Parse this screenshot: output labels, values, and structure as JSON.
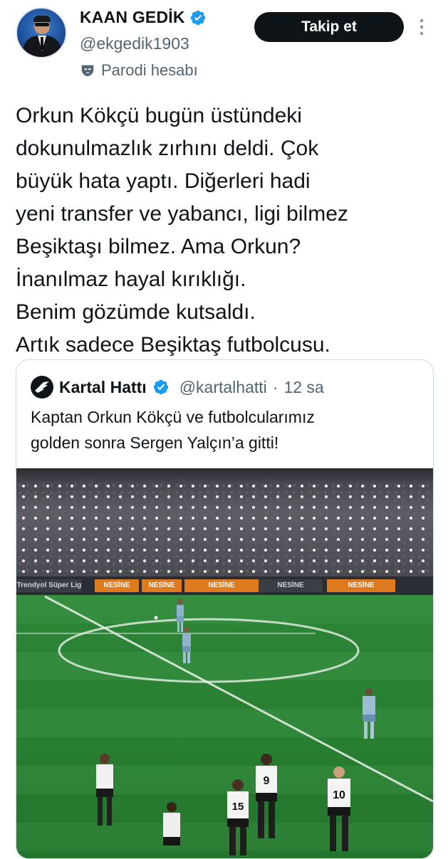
{
  "author": {
    "name": "KAAN GEDİK",
    "handle": "@ekgedik1903",
    "parody_label": "Parodi hesabı",
    "verified": true
  },
  "actions": {
    "follow_label": "Takip et",
    "more_icon": "more-vertical-icon"
  },
  "tweet": {
    "text": "Orkun Kökçü bugün üstündeki\ndokunulmazlık zırhını deldi. Çok\nbüyük hata yaptı. Diğerleri hadi\nyeni transfer ve yabancı, ligi bilmez\nBeşiktaşı bilmez. Ama Orkun?\nİnanılmaz hayal kırıklığı.\nBenim gözümde kutsaldı.\nArtık sadece Beşiktaş futbolcusu."
  },
  "quoted": {
    "name": "Kartal Hattı",
    "handle": "@kartalhatti",
    "separator": "·",
    "time": "12 sa",
    "text": "Kaptan Orkun Kökçü ve futbolcularımız\ngolden sonra Sergen Yalçın’a gitti!",
    "media": {
      "description_icon": "stadium-photo",
      "ads": [
        "NESİNE",
        "NESİNE",
        "NESİNE",
        "NESİNE",
        "NESİNE"
      ],
      "league_text": "Trendyol Süper Lig",
      "jersey_numbers": [
        "9",
        "15",
        "10"
      ]
    }
  },
  "colors": {
    "text_primary": "#0f1419",
    "text_secondary": "#536471",
    "verified_blue": "#1d9bf0",
    "button_bg": "#0f1419",
    "border": "#cfd9de",
    "pitch_green": "#2f8a3a"
  }
}
